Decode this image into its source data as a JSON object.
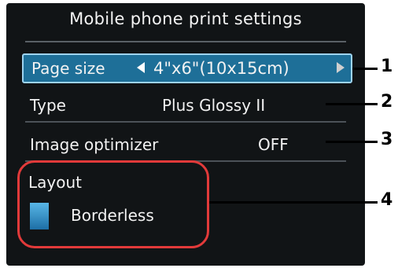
{
  "screen": {
    "title": "Mobile phone print settings"
  },
  "settings": [
    {
      "label": "Page size",
      "value": "4\"x6\"(10x15cm)"
    },
    {
      "label": "Type",
      "value": "Plus Glossy II"
    },
    {
      "label": "Image optimizer",
      "value": "OFF"
    }
  ],
  "layout": {
    "label": "Layout",
    "value": "Borderless"
  },
  "callouts": [
    "1",
    "2",
    "3",
    "4"
  ],
  "colors": {
    "screen_bg": "#111416",
    "selected_row": "#1e6f98",
    "selected_border": "#9ed3ef",
    "highlight": "#e23a3a"
  },
  "icons": {
    "left_arrow": "left-triangle",
    "right_arrow": "right-triangle",
    "layout_thumbnail": "borderless-thumbnail"
  }
}
